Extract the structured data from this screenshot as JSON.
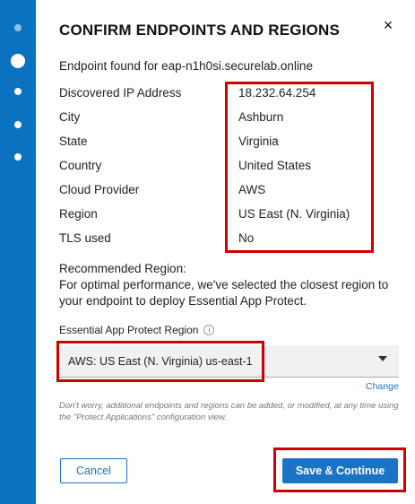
{
  "dialog": {
    "title": "CONFIRM ENDPOINTS AND REGIONS",
    "close_symbol": "×",
    "endpoint_found": "Endpoint found for eap-n1h0si.securelab.online"
  },
  "details": [
    {
      "label": "Discovered IP Address",
      "value": "18.232.64.254"
    },
    {
      "label": "City",
      "value": "Ashburn"
    },
    {
      "label": "State",
      "value": "Virginia"
    },
    {
      "label": "Country",
      "value": "United States"
    },
    {
      "label": "Cloud Provider",
      "value": "AWS"
    },
    {
      "label": "Region",
      "value": "US East (N. Virginia)"
    },
    {
      "label": "TLS used",
      "value": "No"
    }
  ],
  "recommendation": {
    "heading": "Recommended Region:",
    "text": "For optimal performance, we've selected the closest region to your endpoint to deploy Essential App Protect."
  },
  "region_select": {
    "label": "Essential App Protect Region",
    "info_symbol": "i",
    "selected": "AWS: US East (N. Virginia) us-east-1",
    "change_link": "Change"
  },
  "note": "Don't worry, additional endpoints and regions can be added, or modified, at any time using the \"Protect Applications\" configuration view.",
  "buttons": {
    "cancel": "Cancel",
    "save": "Save & Continue"
  },
  "stepper": {
    "total_steps": 5,
    "current_step": 2
  },
  "colors": {
    "sidebar": "#0a72bf",
    "primary": "#1a73c4",
    "highlight": "#cc0000"
  }
}
